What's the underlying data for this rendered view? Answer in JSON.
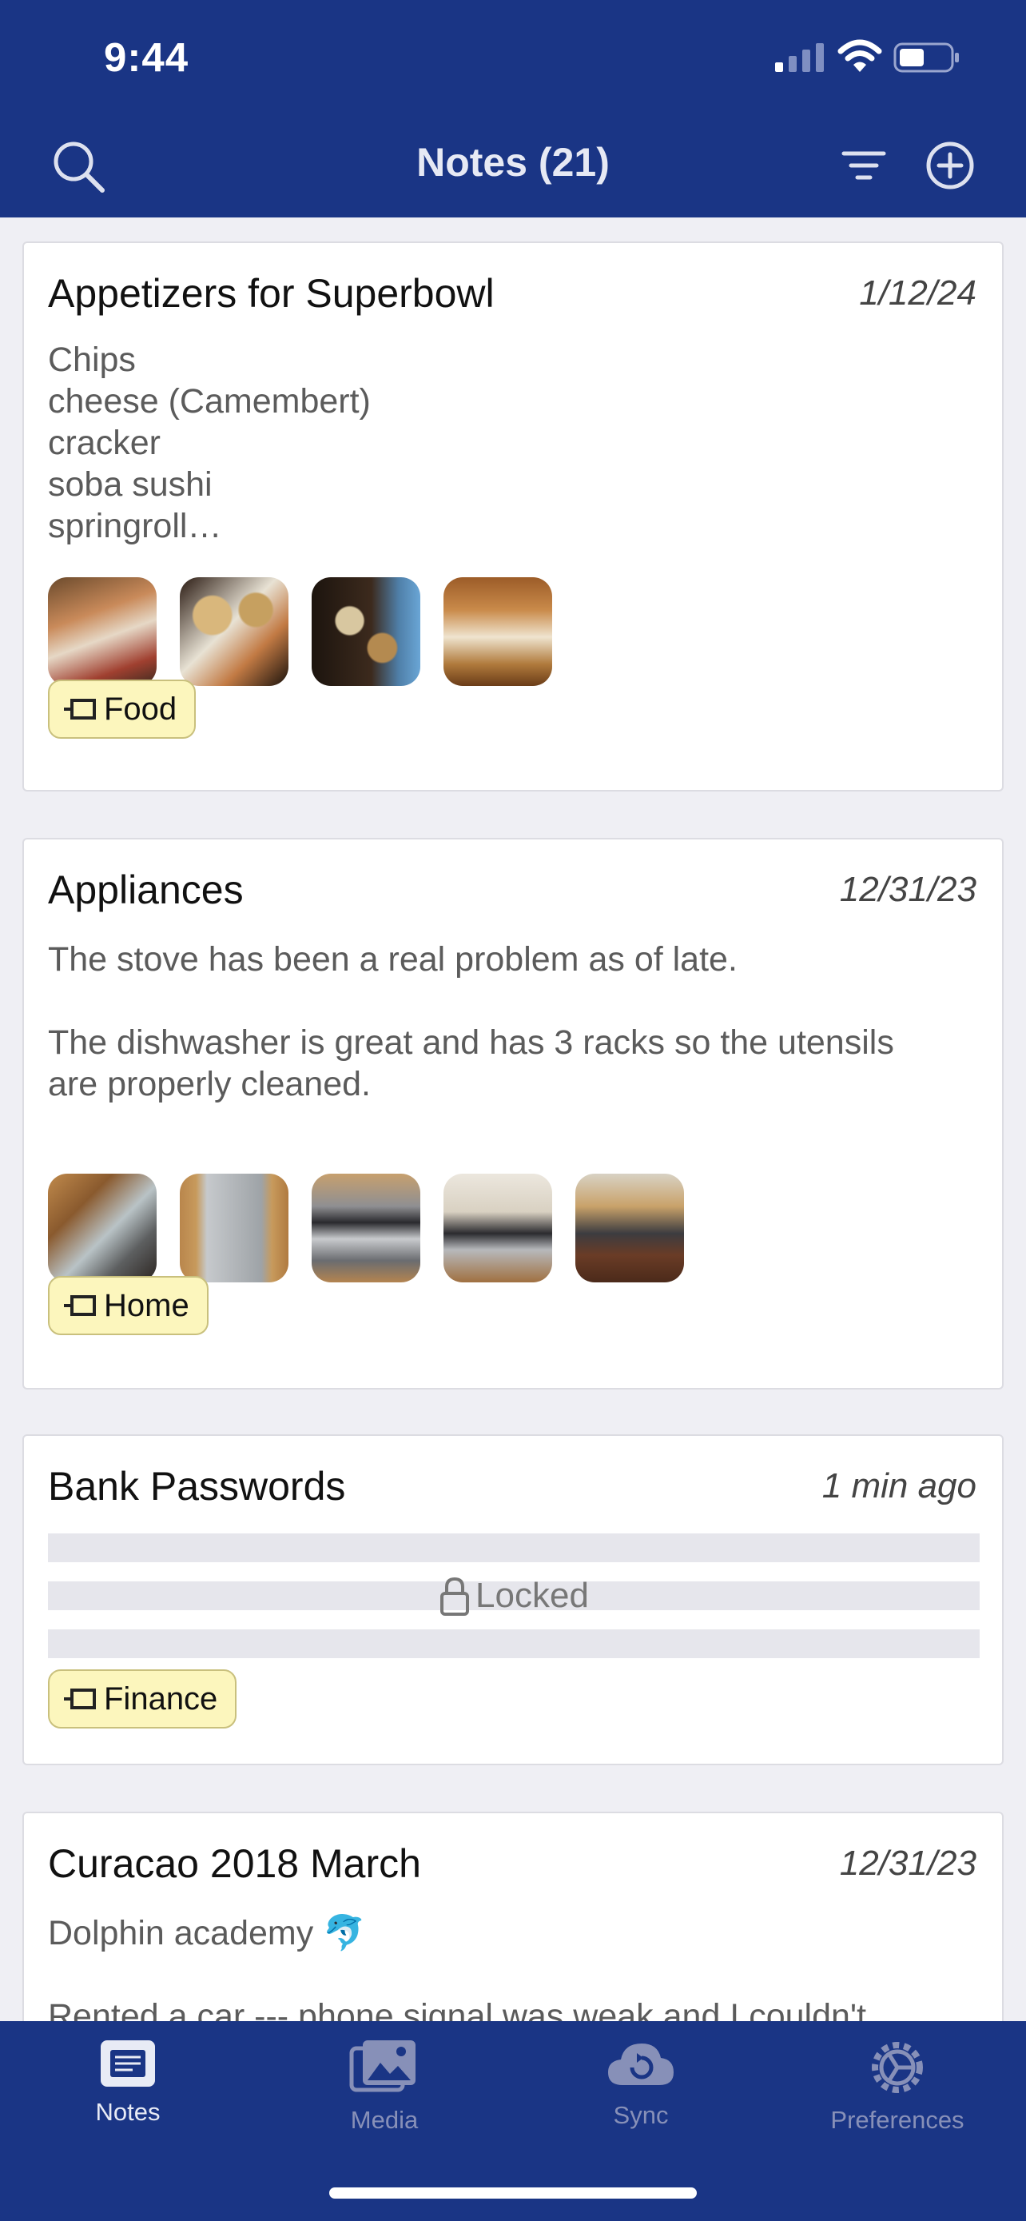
{
  "status_bar": {
    "time": "9:44"
  },
  "header": {
    "title": "Notes (21)"
  },
  "notes": [
    {
      "title": "Appetizers for Superbowl",
      "date": "1/12/24",
      "body": "Chips\ncheese (Camembert)\ncracker\nsoba sushi\nspringroll…",
      "tag": "Food",
      "photo_count": 4
    },
    {
      "title": "Appliances",
      "date": "12/31/23",
      "body": "The stove has been a real problem as of late.\n\nThe dishwasher is great and has 3 racks so the utensils\nare properly cleaned.",
      "tag": "Home",
      "photo_count": 5
    },
    {
      "title": "Bank Passwords",
      "date": "1 min ago",
      "locked_label": "Locked",
      "tag": "Finance"
    },
    {
      "title": "Curacao 2018 March",
      "date": "12/31/23",
      "body": "Dolphin academy 🐬\n\nRented a car --- phone signal was weak and I couldn't"
    }
  ],
  "tabbar": {
    "tabs": [
      {
        "label": "Notes",
        "icon": "notes-icon",
        "active": true
      },
      {
        "label": "Media",
        "icon": "media-icon",
        "active": false
      },
      {
        "label": "Sync",
        "icon": "sync-icon",
        "active": false
      },
      {
        "label": "Preferences",
        "icon": "preferences-icon",
        "active": false
      }
    ]
  },
  "colors": {
    "nav_bg": "#1a3585",
    "tag_bg": "#fcf6bd",
    "page_bg": "#efeff4"
  }
}
